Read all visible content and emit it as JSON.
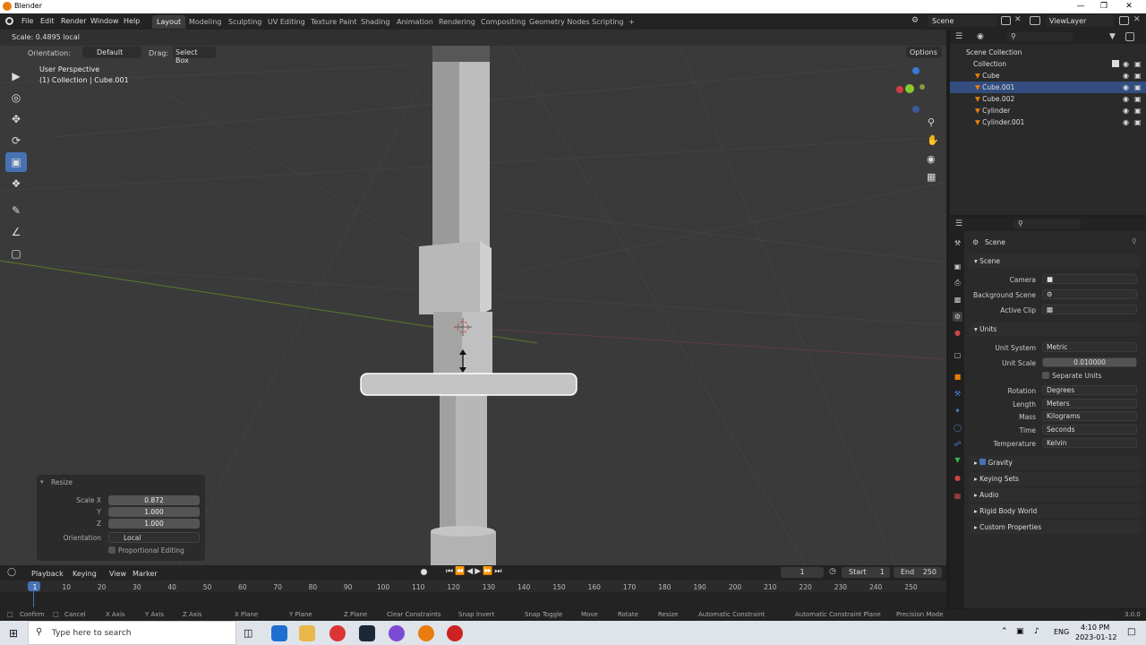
{
  "window": {
    "title": "Blender"
  },
  "menu": [
    "File",
    "Edit",
    "Render",
    "Window",
    "Help"
  ],
  "workspaces": [
    "Layout",
    "Modeling",
    "Sculpting",
    "UV Editing",
    "Texture Paint",
    "Shading",
    "Animation",
    "Rendering",
    "Compositing",
    "Geometry Nodes",
    "Scripting",
    "+"
  ],
  "active_workspace": "Layout",
  "scene_selector": "Scene",
  "viewlayer_selector": "ViewLayer",
  "viewport": {
    "operation_text": "Scale: 0.4895 local",
    "orientation_label": "Orientation:",
    "orientation_value": "Default",
    "drag_label": "Drag:",
    "drag_value": "Select Box",
    "options": "Options",
    "view_name": "User Perspective",
    "view_context": "(1) Collection | Cube.001"
  },
  "resize_panel": {
    "title": "Resize",
    "scale_x_label": "Scale X",
    "scale_x": "0.872",
    "y_label": "Y",
    "y": "1.000",
    "z_label": "Z",
    "z": "1.000",
    "orientation_label": "Orientation",
    "orientation": "Local",
    "proportional": "Proportional Editing"
  },
  "outliner": {
    "scene_collection": "Scene Collection",
    "collection": "Collection",
    "items": [
      "Cube",
      "Cube.001",
      "Cube.002",
      "Cylinder",
      "Cylinder.001"
    ],
    "selected": "Cube.001"
  },
  "properties": {
    "context": "Scene",
    "scene_section": "Scene",
    "camera_label": "Camera",
    "background_scene_label": "Background Scene",
    "active_clip_label": "Active Clip",
    "units_section": "Units",
    "unit_system_label": "Unit System",
    "unit_system": "Metric",
    "unit_scale_label": "Unit Scale",
    "unit_scale": "0.010000",
    "separate_units": "Separate Units",
    "rotation_label": "Rotation",
    "rotation": "Degrees",
    "length_label": "Length",
    "length": "Meters",
    "mass_label": "Mass",
    "mass": "Kilograms",
    "time_label": "Time",
    "time": "Seconds",
    "temperature_label": "Temperature",
    "temperature": "Kelvin",
    "gravity": "Gravity",
    "keying_sets": "Keying Sets",
    "audio": "Audio",
    "rigid_body_world": "Rigid Body World",
    "custom_properties": "Custom Properties"
  },
  "timeline": {
    "playback": "Playback",
    "keying": "Keying",
    "view": "View",
    "marker": "Marker",
    "current_frame": "1",
    "start_label": "Start",
    "start": "1",
    "end_label": "End",
    "end": "250",
    "ticks": [
      "1",
      "10",
      "20",
      "30",
      "40",
      "50",
      "60",
      "70",
      "80",
      "90",
      "100",
      "110",
      "120",
      "130",
      "140",
      "150",
      "160",
      "170",
      "180",
      "190",
      "200",
      "210",
      "220",
      "230",
      "240",
      "250"
    ]
  },
  "statusbar": [
    "Confirm",
    "Cancel",
    "X Axis",
    "Y Axis",
    "Z Axis",
    "X Plane",
    "Y Plane",
    "Z Plane",
    "Clear Constraints",
    "Snap Invert",
    "Snap Toggle",
    "Move",
    "Rotate",
    "Resize",
    "Automatic Constraint",
    "Automatic Constraint Plane",
    "Precision Mode"
  ],
  "version": "3.0.0",
  "taskbar": {
    "search_placeholder": "Type here to search",
    "time": "4:10 PM",
    "date": "2023-01-12",
    "lang": "ENG"
  },
  "colors": {
    "accent": "#4772b3",
    "selection": "#334d80",
    "blender_orange": "#e87d0d"
  }
}
